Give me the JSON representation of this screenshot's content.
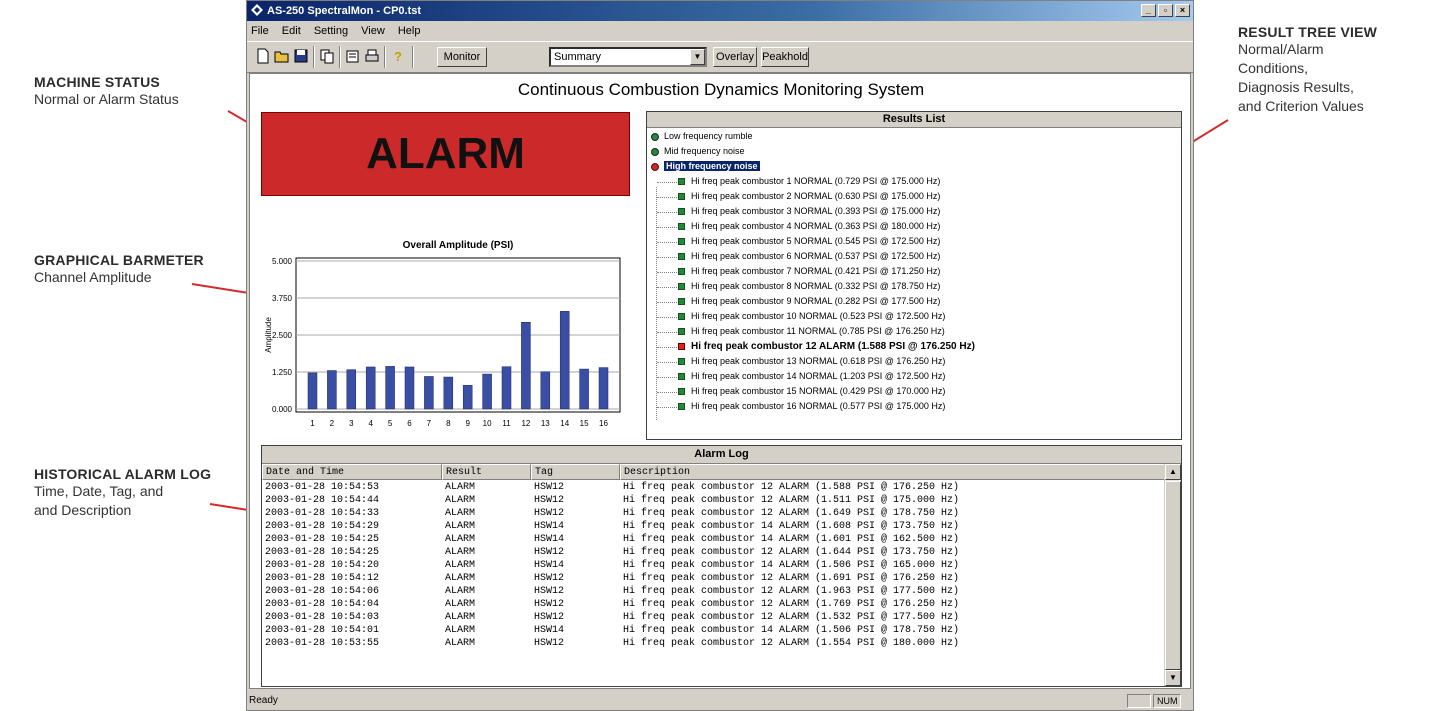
{
  "callouts": {
    "machine_status": {
      "title": "MACHINE STATUS",
      "lines": [
        "Normal or Alarm Status"
      ]
    },
    "barmeter": {
      "title": "GRAPHICAL BARMETER",
      "lines": [
        "Channel Amplitude"
      ]
    },
    "alarm_log": {
      "title": "HISTORICAL ALARM LOG",
      "lines": [
        "Time, Date, Tag, and",
        "and Description"
      ]
    },
    "result_tree": {
      "title": "RESULT TREE VIEW",
      "lines": [
        "Normal/Alarm",
        "Conditions,",
        "Diagnosis Results,",
        "and Criterion Values"
      ]
    }
  },
  "window": {
    "title": "AS-250 SpectralMon - CP0.tst",
    "menu": [
      "File",
      "Edit",
      "Setting",
      "View",
      "Help"
    ],
    "toolbar": {
      "monitor_label": "Monitor",
      "view_select": "Summary",
      "overlay_label": "Overlay",
      "peakhold_label": "Peakhold"
    },
    "app_title": "Continuous Combustion Dynamics Monitoring System",
    "status_text": "ALARM",
    "status_color": "#cc2a2a"
  },
  "chart_data": {
    "type": "bar",
    "title": "Overall Amplitude (PSI)",
    "xlabel": "",
    "ylabel": "Amplitude",
    "categories": [
      "1",
      "2",
      "3",
      "4",
      "5",
      "6",
      "7",
      "8",
      "9",
      "10",
      "11",
      "12",
      "13",
      "14",
      "15",
      "16"
    ],
    "values": [
      1.22,
      1.3,
      1.33,
      1.42,
      1.44,
      1.42,
      1.1,
      1.08,
      0.8,
      1.18,
      1.43,
      2.93,
      1.26,
      3.3,
      1.35,
      1.4
    ],
    "yticks": [
      "0.000",
      "1.250",
      "2.500",
      "3.750",
      "5.000"
    ],
    "ylim": [
      0,
      5
    ],
    "grid": true,
    "bar_color": "#3a4ea3"
  },
  "results": {
    "header": "Results List",
    "root_items": [
      {
        "label": "Low frequency rumble",
        "status": "normal"
      },
      {
        "label": "Mid frequency noise",
        "status": "normal"
      },
      {
        "label": "High frequency noise",
        "status": "alarm",
        "selected": true
      }
    ],
    "children": [
      {
        "text": "Hi freq peak combustor 1 NORMAL (0.729 PSI @ 175.000 Hz)",
        "alarm": false
      },
      {
        "text": "Hi freq peak combustor 2 NORMAL (0.630 PSI @ 175.000 Hz)",
        "alarm": false
      },
      {
        "text": "Hi freq peak combustor 3 NORMAL (0.393 PSI @ 175.000 Hz)",
        "alarm": false
      },
      {
        "text": "Hi freq peak combustor 4 NORMAL (0.363 PSI @ 180.000 Hz)",
        "alarm": false
      },
      {
        "text": "Hi freq peak combustor 5 NORMAL (0.545 PSI @ 172.500 Hz)",
        "alarm": false
      },
      {
        "text": "Hi freq peak combustor 6 NORMAL (0.537 PSI @ 172.500 Hz)",
        "alarm": false
      },
      {
        "text": "Hi freq peak combustor 7 NORMAL (0.421 PSI @ 171.250 Hz)",
        "alarm": false
      },
      {
        "text": "Hi freq peak combustor 8 NORMAL (0.332 PSI @ 178.750 Hz)",
        "alarm": false
      },
      {
        "text": "Hi freq peak combustor 9 NORMAL (0.282 PSI @ 177.500 Hz)",
        "alarm": false
      },
      {
        "text": "Hi freq peak combustor 10 NORMAL (0.523 PSI @ 172.500 Hz)",
        "alarm": false
      },
      {
        "text": "Hi freq peak combustor 11 NORMAL (0.785 PSI @ 176.250 Hz)",
        "alarm": false
      },
      {
        "text": "Hi freq peak combustor 12 ALARM (1.588 PSI @ 176.250 Hz)",
        "alarm": true
      },
      {
        "text": "Hi freq peak combustor 13 NORMAL (0.618 PSI @ 176.250 Hz)",
        "alarm": false
      },
      {
        "text": "Hi freq peak combustor 14 NORMAL (1.203 PSI @ 172.500 Hz)",
        "alarm": false
      },
      {
        "text": "Hi freq peak combustor 15 NORMAL (0.429 PSI @ 170.000 Hz)",
        "alarm": false
      },
      {
        "text": "Hi freq peak combustor 16 NORMAL (0.577 PSI @ 175.000 Hz)",
        "alarm": false
      }
    ],
    "colors": {
      "normal": "#1f8a3a",
      "alarm": "#e02020"
    }
  },
  "alarm_log": {
    "header": "Alarm Log",
    "columns": [
      "Date and Time",
      "Result",
      "Tag",
      "Description"
    ],
    "rows": [
      [
        "2003-01-28 10:54:53",
        "ALARM",
        "HSW12",
        "Hi freq peak combustor 12 ALARM (1.588 PSI @ 176.250 Hz)"
      ],
      [
        "2003-01-28 10:54:44",
        "ALARM",
        "HSW12",
        "Hi freq peak combustor 12 ALARM (1.511 PSI @ 175.000 Hz)"
      ],
      [
        "2003-01-28 10:54:33",
        "ALARM",
        "HSW12",
        "Hi freq peak combustor 12 ALARM (1.649 PSI @ 178.750 Hz)"
      ],
      [
        "2003-01-28 10:54:29",
        "ALARM",
        "HSW14",
        "Hi freq peak combustor 14 ALARM (1.608 PSI @ 173.750 Hz)"
      ],
      [
        "2003-01-28 10:54:25",
        "ALARM",
        "HSW14",
        "Hi freq peak combustor 14 ALARM (1.601 PSI @ 162.500 Hz)"
      ],
      [
        "2003-01-28 10:54:25",
        "ALARM",
        "HSW12",
        "Hi freq peak combustor 12 ALARM (1.644 PSI @ 173.750 Hz)"
      ],
      [
        "2003-01-28 10:54:20",
        "ALARM",
        "HSW14",
        "Hi freq peak combustor 14 ALARM (1.506 PSI @ 165.000 Hz)"
      ],
      [
        "2003-01-28 10:54:12",
        "ALARM",
        "HSW12",
        "Hi freq peak combustor 12 ALARM (1.691 PSI @ 176.250 Hz)"
      ],
      [
        "2003-01-28 10:54:06",
        "ALARM",
        "HSW12",
        "Hi freq peak combustor 12 ALARM (1.963 PSI @ 177.500 Hz)"
      ],
      [
        "2003-01-28 10:54:04",
        "ALARM",
        "HSW12",
        "Hi freq peak combustor 12 ALARM (1.769 PSI @ 176.250 Hz)"
      ],
      [
        "2003-01-28 10:54:03",
        "ALARM",
        "HSW12",
        "Hi freq peak combustor 12 ALARM (1.532 PSI @ 177.500 Hz)"
      ],
      [
        "2003-01-28 10:54:01",
        "ALARM",
        "HSW14",
        "Hi freq peak combustor 14 ALARM (1.506 PSI @ 178.750 Hz)"
      ],
      [
        "2003-01-28 10:53:55",
        "ALARM",
        "HSW12",
        "Hi freq peak combustor 12 ALARM (1.554 PSI @ 180.000 Hz)"
      ]
    ]
  },
  "statusbar": {
    "ready": "Ready",
    "num": "NUM"
  }
}
